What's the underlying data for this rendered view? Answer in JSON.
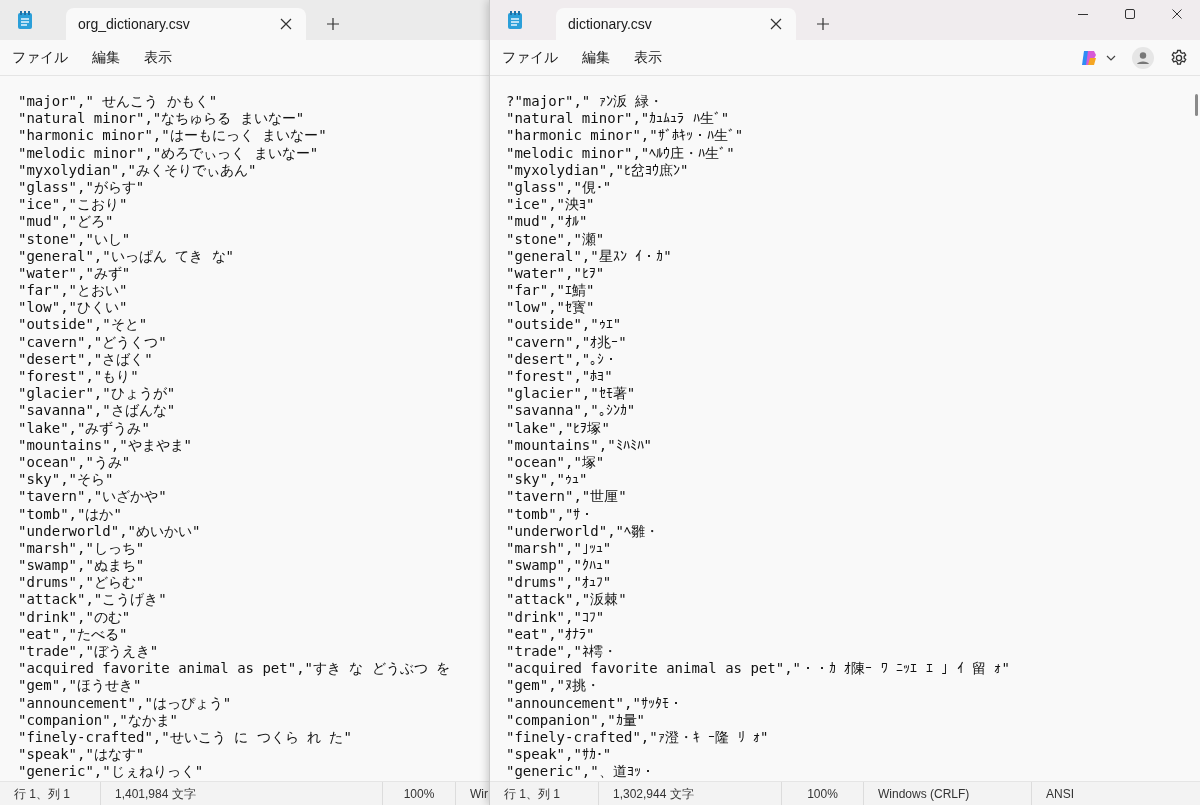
{
  "windows": [
    {
      "focused": false,
      "tab_title": "org_dictionary.csv",
      "menu": [
        "ファイル",
        "編集",
        "表示"
      ],
      "lines": [
        "\"major\",\" せんこう かもく\"",
        "\"natural minor\",\"なちゅらる まいなー\"",
        "\"harmonic minor\",\"はーもにっく まいなー\"",
        "\"melodic minor\",\"めろでぃっく まいなー\"",
        "\"myxolydian\",\"みくそりでぃあん\"",
        "\"glass\",\"がらす\"",
        "\"ice\",\"こおり\"",
        "\"mud\",\"どろ\"",
        "\"stone\",\"いし\"",
        "\"general\",\"いっぱん てき な\"",
        "\"water\",\"みず\"",
        "\"far\",\"とおい\"",
        "\"low\",\"ひくい\"",
        "\"outside\",\"そと\"",
        "\"cavern\",\"どうくつ\"",
        "\"desert\",\"さばく\"",
        "\"forest\",\"もり\"",
        "\"glacier\",\"ひょうが\"",
        "\"savanna\",\"さばんな\"",
        "\"lake\",\"みずうみ\"",
        "\"mountains\",\"やまやま\"",
        "\"ocean\",\"うみ\"",
        "\"sky\",\"そら\"",
        "\"tavern\",\"いざかや\"",
        "\"tomb\",\"はか\"",
        "\"underworld\",\"めいかい\"",
        "\"marsh\",\"しっち\"",
        "\"swamp\",\"ぬまち\"",
        "\"drums\",\"どらむ\"",
        "\"attack\",\"こうげき\"",
        "\"drink\",\"のむ\"",
        "\"eat\",\"たべる\"",
        "\"trade\",\"ぼうえき\"",
        "\"acquired favorite animal as pet\",\"すき な どうぶつ を",
        "\"gem\",\"ほうせき\"",
        "\"announcement\",\"はっぴょう\"",
        "\"companion\",\"なかま\"",
        "\"finely-crafted\",\"せいこう に つくら れ た\"",
        "\"speak\",\"はなす\"",
        "\"generic\",\"じぇねりっく\""
      ],
      "status_bar": [
        "行 1、列 1",
        "1,401,984 文字",
        "100%",
        "Wir"
      ]
    },
    {
      "focused": true,
      "tab_title": "dictionary.csv",
      "menu": [
        "ファイル",
        "編集",
        "表示"
      ],
      "lines": [
        "?\"major\",\" ｧﾝ汳 緑・",
        "\"natural minor\",\"ｶｭﾑｭﾗ ﾊ生ﾞ\"",
        "\"harmonic minor\",\"ｻﾞﾎｷｯ・ﾊ生ﾞ\"",
        "\"melodic minor\",\"ﾍﾙｳ庄・ﾊ生ﾞ\"",
        "\"myxolydian\",\"ﾋ岔ﾖｳ庶ﾝ\"",
        "\"glass\",\"俔･\"",
        "\"ice\",\"泱ﾖ\"",
        "\"mud\",\"ｵﾙ\"",
        "\"stone\",\"瀬\"",
        "\"general\",\"星ｽﾝ ｲ・ｶ\"",
        "\"water\",\"ﾋｦ\"",
        "\"far\",\"ｴ鯖\"",
        "\"low\",\"ｾ寳\"",
        "\"outside\",\"ｩｴ\"",
        "\"cavern\",\"ｵ兆ｰ\"",
        "\"desert\",\"｡ｼ・",
        "\"forest\",\"ﾎﾖ\"",
        "\"glacier\",\"ｾﾓ著\"",
        "\"savanna\",\"｡ｼﾝｶ\"",
        "\"lake\",\"ﾋｦ塚\"",
        "\"mountains\",\"ﾐﾊﾐﾊ\"",
        "\"ocean\",\"塚\"",
        "\"sky\",\"ｩｭ\"",
        "\"tavern\",\"世厘\"",
        "\"tomb\",\"ｻ・",
        "\"underworld\",\"ﾍ雛・",
        "\"marsh\",\"｣ｯｭ\"",
        "\"swamp\",\"ｸﾊｭ\"",
        "\"drums\",\"ｵｭﾌ\"",
        "\"attack\",\"汳棘\"",
        "\"drink\",\"ｺﾌ\"",
        "\"eat\",\"ｵﾅﾗ\"",
        "\"trade\",\"ﾈ樗・",
        "\"acquired favorite animal as pet\",\"・・ｶ ｵ陳ｰ ﾜ ﾆｯｴ ｴ ｣ ｲ 留 ｫ\"",
        "\"gem\",\"ﾇ挑・",
        "\"announcement\",\"ｻｯﾀﾓ・",
        "\"companion\",\"ｶ量\"",
        "\"finely-crafted\",\"ｧ澄・ｷ ｰ隆 ﾘ ｫ\"",
        "\"speak\",\"ｻｶ･\"",
        "\"generic\",\"、道ﾖｯ・"
      ],
      "status_bar": [
        "行 1、列 1",
        "1,302,944 文字",
        "100%",
        "Windows (CRLF)",
        "ANSI"
      ]
    }
  ]
}
